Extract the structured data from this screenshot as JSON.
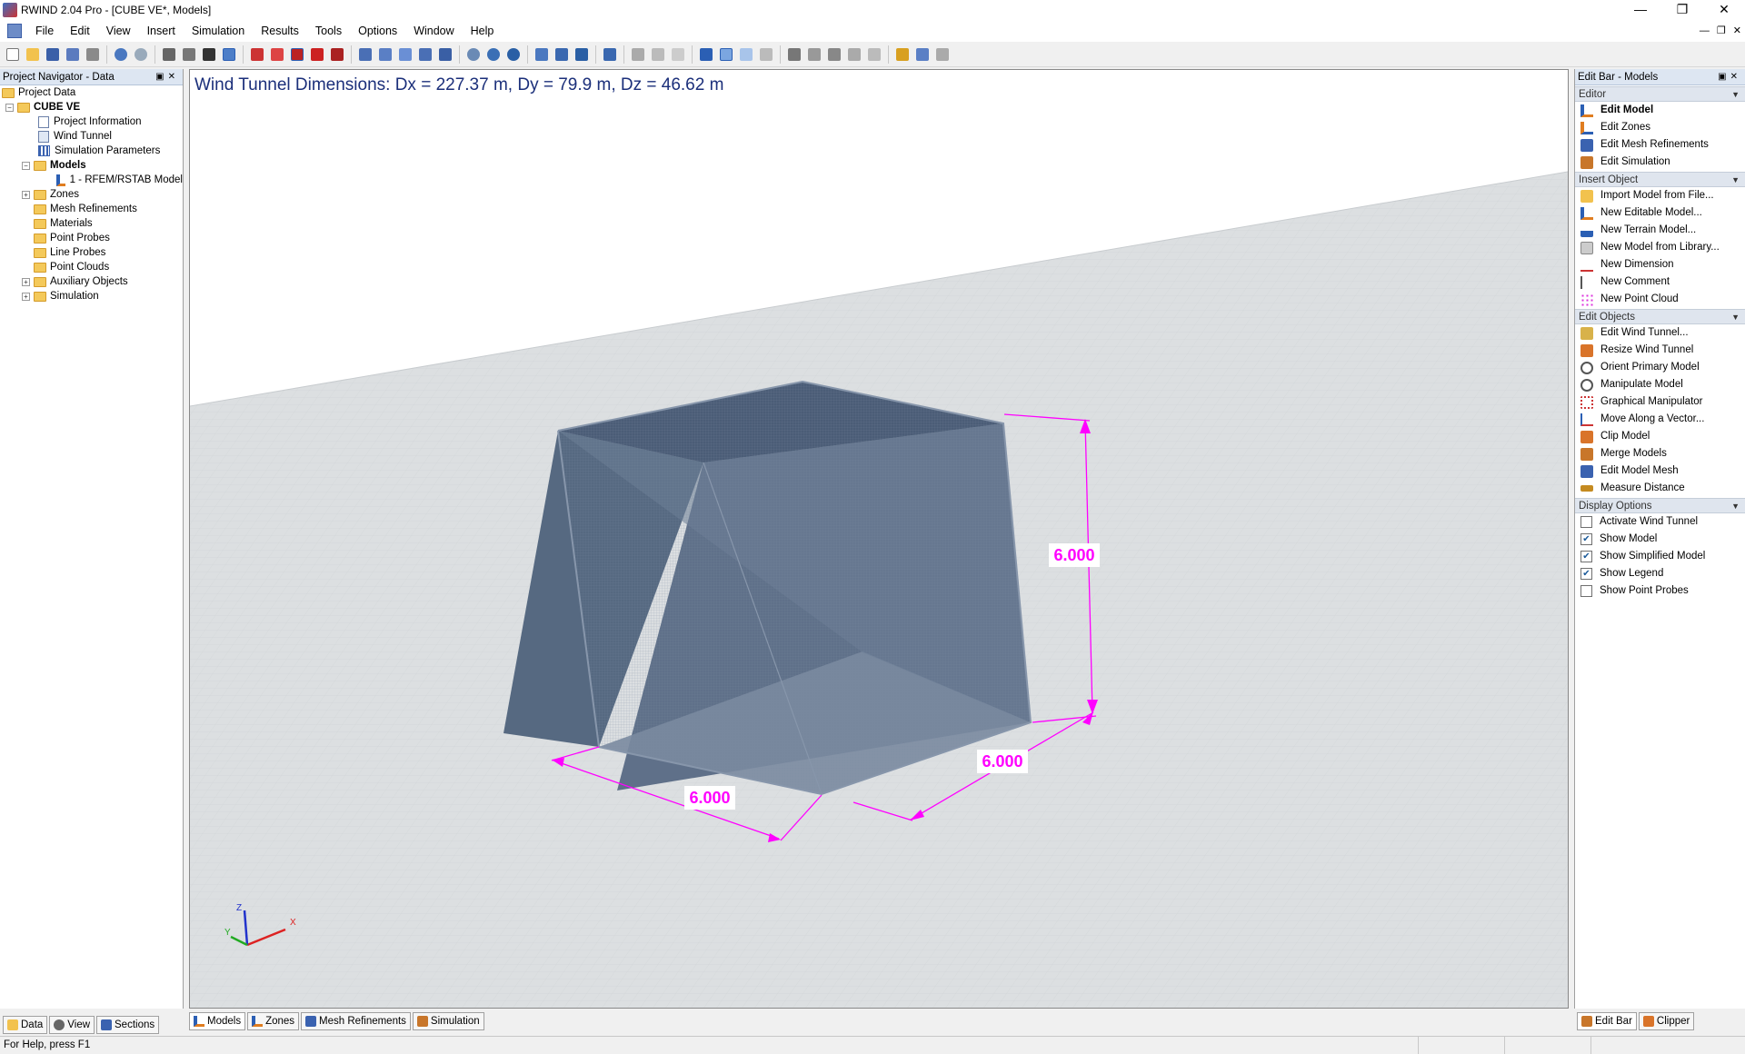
{
  "window": {
    "title": "RWIND 2.04 Pro - [CUBE VE*, Models]"
  },
  "menu": [
    "File",
    "Edit",
    "View",
    "Insert",
    "Simulation",
    "Results",
    "Tools",
    "Options",
    "Window",
    "Help"
  ],
  "left_panel": {
    "title": "Project Navigator - Data",
    "tree": {
      "root": "Project Data",
      "project": "CUBE VE",
      "project_information": "Project Information",
      "wind_tunnel": "Wind Tunnel",
      "simulation_parameters": "Simulation Parameters",
      "models": "Models",
      "model_1": "1 - RFEM/RSTAB Model",
      "zones": "Zones",
      "mesh_refinements": "Mesh Refinements",
      "materials": "Materials",
      "point_probes": "Point Probes",
      "line_probes": "Line Probes",
      "point_clouds": "Point Clouds",
      "auxiliary_objects": "Auxiliary Objects",
      "simulation": "Simulation"
    },
    "tabs": [
      "Data",
      "View",
      "Sections"
    ]
  },
  "viewport": {
    "wind_tunnel_dimensions": "Wind Tunnel Dimensions: Dx = 227.37 m, Dy = 79.9 m, Dz = 46.62 m",
    "dimension_height": "6.000",
    "dimension_depth": "6.000",
    "dimension_width": "6.000",
    "axis_x": "X",
    "axis_y": "Y",
    "axis_z": "Z",
    "dimension_color": "#ff00ff",
    "model_color": "#5d6e85"
  },
  "bottom_tabs": [
    "Models",
    "Zones",
    "Mesh Refinements",
    "Simulation"
  ],
  "right_panel": {
    "title": "Edit Bar - Models",
    "editor_header": "Editor",
    "editor": [
      "Edit Model",
      "Edit Zones",
      "Edit Mesh Refinements",
      "Edit Simulation"
    ],
    "insert_header": "Insert Object",
    "insert": [
      "Import Model from File...",
      "New Editable Model...",
      "New Terrain Model...",
      "New Model from Library...",
      "New Dimension",
      "New Comment",
      "New Point Cloud"
    ],
    "edit_objects_header": "Edit Objects",
    "edit_objects": [
      "Edit Wind Tunnel...",
      "Resize Wind Tunnel",
      "Orient Primary Model",
      "Manipulate Model",
      "Graphical Manipulator",
      "Move Along a Vector...",
      "Clip Model",
      "Merge Models",
      "Edit Model Mesh",
      "Measure Distance"
    ],
    "display_header": "Display Options",
    "display": [
      {
        "label": "Activate Wind Tunnel",
        "checked": false
      },
      {
        "label": "Show Model",
        "checked": true
      },
      {
        "label": "Show Simplified Model",
        "checked": true
      },
      {
        "label": "Show Legend",
        "checked": true
      },
      {
        "label": "Show Point Probes",
        "checked": false
      }
    ],
    "tabs": [
      "Edit Bar",
      "Clipper"
    ]
  },
  "status": {
    "text": "For Help, press F1"
  }
}
